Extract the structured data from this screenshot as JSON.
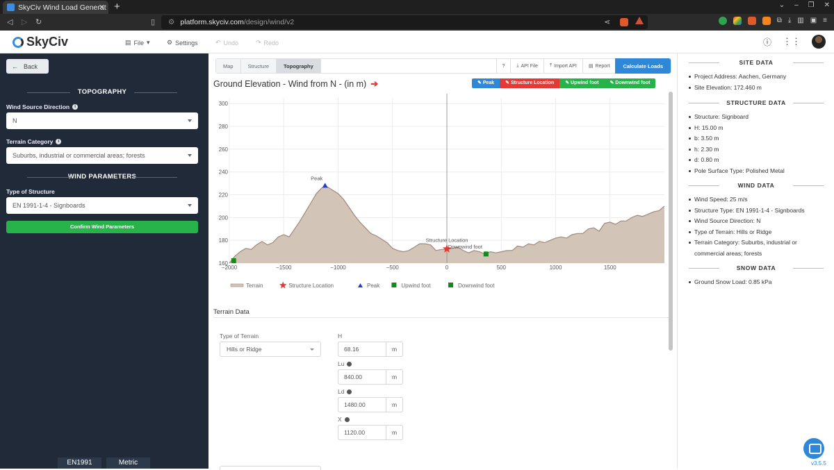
{
  "browser": {
    "tab_title": "SkyCiv Wind Load Generat",
    "url_host": "platform.skyciv.com",
    "url_path": "/design/wind/v2"
  },
  "header": {
    "brand": "SkyCiv",
    "menu": {
      "file": "File",
      "settings": "Settings",
      "undo": "Undo",
      "redo": "Redo"
    }
  },
  "sidebar": {
    "back": "Back",
    "topography_header": "TOPOGRAPHY",
    "wind_source_label": "Wind Source Direction",
    "wind_source_value": "N",
    "terrain_category_label": "Terrain Category",
    "terrain_category_value": "Suburbs, industrial or commercial areas; forests",
    "wind_params_header": "WIND PARAMETERS",
    "structure_type_label": "Type of Structure",
    "structure_type_value": "EN 1991-1-4 - Signboards",
    "confirm_button": "Confirm Wind Parameters",
    "footer_code": "EN1991",
    "footer_units": "Metric"
  },
  "main": {
    "tabs": [
      "Map",
      "Structure",
      "Topography"
    ],
    "active_tab": "Topography",
    "tools": {
      "help": "?",
      "api_file": "API File",
      "import_api": "Import API",
      "report": "Report",
      "calculate": "Calculate Loads"
    },
    "chart_title": "Ground Elevation - Wind from N - (in m)",
    "chart_buttons": {
      "peak": "Peak",
      "structure_location": "Structure Location",
      "upwind_foot": "Upwind foot",
      "downwind_foot": "Downwind foot"
    },
    "terrain_section": "Terrain Data",
    "fields": {
      "type_label": "Type of Terrain",
      "type_value": "Hills or Ridge",
      "H_label": "H",
      "H_value": "68.16",
      "H_unit": "m",
      "Lu_label": "Lu",
      "Lu_value": "840.00",
      "Lu_unit": "m",
      "Ld_label": "Ld",
      "Ld_value": "1480.00",
      "Ld_unit": "m",
      "X_label": "X",
      "X_value": "1120.00",
      "X_unit": "m"
    }
  },
  "chart_data": {
    "type": "area",
    "x": [
      -2000,
      -1950,
      -1900,
      -1850,
      -1800,
      -1750,
      -1700,
      -1650,
      -1600,
      -1550,
      -1500,
      -1450,
      -1400,
      -1350,
      -1300,
      -1250,
      -1200,
      -1150,
      -1120,
      -1100,
      -1050,
      -1000,
      -950,
      -900,
      -850,
      -800,
      -750,
      -700,
      -650,
      -600,
      -550,
      -500,
      -450,
      -400,
      -350,
      -300,
      -250,
      -200,
      -150,
      -100,
      -50,
      0,
      50,
      100,
      150,
      200,
      250,
      300,
      350,
      400,
      450,
      500,
      550,
      600,
      650,
      700,
      750,
      800,
      850,
      900,
      950,
      1000,
      1050,
      1100,
      1150,
      1200,
      1250,
      1300,
      1350,
      1400,
      1450,
      1500,
      1550,
      1600,
      1650,
      1700,
      1750,
      1800,
      1850,
      1900,
      1950,
      2000
    ],
    "y": [
      160,
      166,
      170,
      173,
      172,
      176,
      179,
      176,
      178,
      183,
      185,
      183,
      190,
      197,
      205,
      213,
      221,
      226,
      228,
      227,
      224,
      221,
      216,
      209,
      202,
      196,
      191,
      186,
      184,
      181,
      178,
      173,
      171,
      170,
      171,
      174,
      177,
      177,
      176,
      171,
      172,
      172,
      173,
      174,
      171,
      169,
      171,
      170,
      168,
      170,
      169,
      170,
      171,
      171,
      175,
      174,
      177,
      176,
      179,
      178,
      180,
      182,
      183,
      182,
      185,
      186,
      186,
      190,
      191,
      188,
      195,
      196,
      194,
      197,
      197,
      200,
      202,
      201,
      203,
      205,
      206,
      210
    ],
    "xlim": [
      -2000,
      2000
    ],
    "ylim": [
      160,
      305
    ],
    "xticks": [
      "−2000",
      "−1500",
      "−1000",
      "−500",
      "0",
      "500",
      "1000",
      "1500"
    ],
    "yticks": [
      "160",
      "180",
      "200",
      "220",
      "240",
      "260",
      "280",
      "300"
    ],
    "markers": {
      "peak": {
        "x": -1120,
        "y": 228,
        "label": "Peak"
      },
      "structure": {
        "x": 0,
        "y": 172.46,
        "label": "Structure Location"
      },
      "upwind": {
        "x": -1960,
        "y": 160
      },
      "downwind": {
        "x": 360,
        "y": 168,
        "label": "Downwind foot"
      }
    },
    "legend": [
      "Terrain",
      "Structure Location",
      "Peak",
      "Upwind foot",
      "Downwind foot"
    ],
    "colors": {
      "terrain": "#d3c4b8",
      "terrain_line": "#9e8a7a",
      "structure": "#e53935",
      "peak": "#1e3fd4",
      "foot": "#138a1a"
    }
  },
  "right_panel": {
    "site_header": "SITE DATA",
    "site": [
      "Project Address: Aachen, Germany",
      "Site Elevation: 172.460 m"
    ],
    "structure_header": "STRUCTURE DATA",
    "structure": [
      "Structure: Signboard",
      "H: 15.00 m",
      "b: 3.50 m",
      "h: 2.30 m",
      "d: 0.80 m",
      "Pole Surface Type: Polished Metal"
    ],
    "wind_header": "WIND DATA",
    "wind": [
      "Wind Speed: 25 m/s",
      "Structure Type: EN 1991-1-4 - Signboards",
      "Wind Source Direction: N",
      "Type of Terrain: Hills or Ridge",
      "Terrain Category: Suburbs, industrial or commercial areas; forests"
    ],
    "snow_header": "SNOW DATA",
    "snow": [
      "Ground Snow Load: 0.85 kPa"
    ],
    "version": "v3.5.5"
  }
}
